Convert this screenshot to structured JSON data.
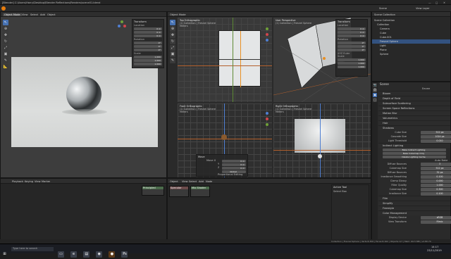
{
  "window": {
    "title": "[Blender] C:\\Users\\Harry\\Desktop\\Blender Reflections\\Renders\\scene01.blend"
  },
  "menu": [
    "File",
    "Edit",
    "Render",
    "Window",
    "Help"
  ],
  "workspaces": [
    {
      "label": "Layout",
      "active": true
    },
    {
      "label": "Modeling",
      "active": false
    },
    {
      "label": "Sculpting",
      "active": false
    },
    {
      "label": "UV Editing",
      "active": false
    },
    {
      "label": "Texture Paint",
      "active": false
    },
    {
      "label": "Shading",
      "active": false
    },
    {
      "label": "Animation",
      "active": false
    },
    {
      "label": "Rendering",
      "active": false
    },
    {
      "label": "Compositing",
      "active": false
    },
    {
      "label": "Scripting",
      "active": false
    }
  ],
  "header_right": {
    "scene": "Scene",
    "view_layer": "View Layer"
  },
  "viewport_left": {
    "mode": "Object Mode",
    "menus": [
      "View",
      "Select",
      "Add",
      "Object"
    ],
    "npanel": {
      "sections": [
        "Transform",
        "Location",
        "Rotation",
        "XYZ Euler",
        "Scale"
      ],
      "values": [
        "0 m",
        "0 m",
        "0 m",
        "0°",
        "0°",
        "0°",
        "1.000",
        "1.000",
        "1.000"
      ]
    }
  },
  "viewports": {
    "top": {
      "title": "Top Orthographic",
      "sub": "(1) Collection | Fresnel Sphere",
      "unit": "Meters"
    },
    "user": {
      "title": "User Perspective",
      "sub": "(1) Collection | Fresnel Sphere"
    },
    "front": {
      "title": "Front Orthographic",
      "sub": "(1) Collection | Fresnel Sphere",
      "unit": "Meters"
    },
    "right": {
      "title": "Right Orthographic",
      "sub": "(1) Collection | Fresnel Sphere",
      "unit": "Meters"
    },
    "right_npanel": {
      "sections": [
        "Transform",
        "Location",
        "Rotation",
        "XYZ Euler",
        "Scale"
      ],
      "values": [
        "0 m",
        "0 m",
        "0 m",
        "0°",
        "0°",
        "0°",
        "1.000",
        "1.000",
        "1.000"
      ]
    }
  },
  "redo_panel": {
    "title": "Move",
    "rows": [
      {
        "label": "Move X",
        "value": "0 m"
      },
      {
        "label": "Y",
        "value": "0 m"
      },
      {
        "label": "Z",
        "value": "0 m"
      }
    ],
    "orientation": "Global",
    "proportional": "Proportional Editing"
  },
  "outliner": {
    "title": "Scene Collection",
    "items": [
      {
        "label": "Scene Collection",
        "selected": false
      },
      {
        "label": "Collection",
        "selected": false
      },
      {
        "label": "Camera",
        "selected": false
      },
      {
        "label": "Cube",
        "selected": false
      },
      {
        "label": "Cube.001",
        "selected": false
      },
      {
        "label": "Fresnel Sphere",
        "selected": true
      },
      {
        "label": "Light",
        "selected": false
      },
      {
        "label": "Plane",
        "selected": false
      },
      {
        "label": "Sphere",
        "selected": false
      }
    ]
  },
  "properties": {
    "context": "Scene",
    "render_engine": "Eevee",
    "sections": [
      {
        "label": "Bloom",
        "open": false
      },
      {
        "label": "Depth of Field",
        "open": false
      },
      {
        "label": "Subsurface Scattering",
        "open": false
      },
      {
        "label": "Screen Space Reflections",
        "open": false
      },
      {
        "label": "Motion Blur",
        "open": false
      },
      {
        "label": "Volumetrics",
        "open": false
      },
      {
        "label": "Hair",
        "open": false
      },
      {
        "label": "Shadows",
        "open": true
      }
    ],
    "shadow_rows": [
      {
        "label": "Cube Size",
        "value": "512 px"
      },
      {
        "label": "Cascade Size",
        "value": "1024 px"
      },
      {
        "label": "Light Threshold",
        "value": "0.010"
      }
    ],
    "indirect": {
      "title": "Indirect Lighting",
      "buttons": [
        "Bake Indirect Lighting",
        "Bake Cubemap Only",
        "Delete Lighting Cache"
      ],
      "auto_bake": "Auto Bake",
      "rows": [
        {
          "label": "Diffuse Bounces",
          "value": "3"
        },
        {
          "label": "Cubemap Size",
          "value": "512 px"
        },
        {
          "label": "Diffuse Bounces",
          "value": "32 px"
        },
        {
          "label": "Irradiance Smoothing",
          "value": "0.100"
        },
        {
          "label": "Clamp Glossy",
          "value": "0.000"
        },
        {
          "label": "Filter Quality",
          "value": "1.000"
        }
      ]
    },
    "display_rows": [
      {
        "label": "Cubemap Size",
        "value": "0.300"
      },
      {
        "label": "Irradiance Size",
        "value": "0.100"
      }
    ],
    "tail_sections": [
      "Film",
      "Simplify",
      "Freestyle",
      "Color Management"
    ],
    "cm_rows": [
      {
        "label": "Display Device",
        "value": "sRGB"
      },
      {
        "label": "View Transform",
        "value": "Filmic"
      }
    ]
  },
  "timeline": {
    "menus": [
      "Playback",
      "Keying",
      "View",
      "Marker"
    ],
    "node_menus": [
      "Object",
      "View",
      "Select",
      "Add",
      "Node"
    ],
    "nodes": [
      {
        "title": "Principled"
      },
      {
        "title": "Specular"
      },
      {
        "title": "Mix Shader"
      }
    ],
    "right_panel": {
      "title": "Active Tool",
      "item": "Select Box"
    }
  },
  "statusbar": {
    "text": "Collection | Fresnel Sphere | Verts:8,306 | Faces:8,162 | Objects:1/7 | Mem: 60.5 MB | v2.80.74"
  },
  "taskbar": {
    "search": "Type here to search",
    "time": "14:17",
    "date": "23/11/2019"
  }
}
